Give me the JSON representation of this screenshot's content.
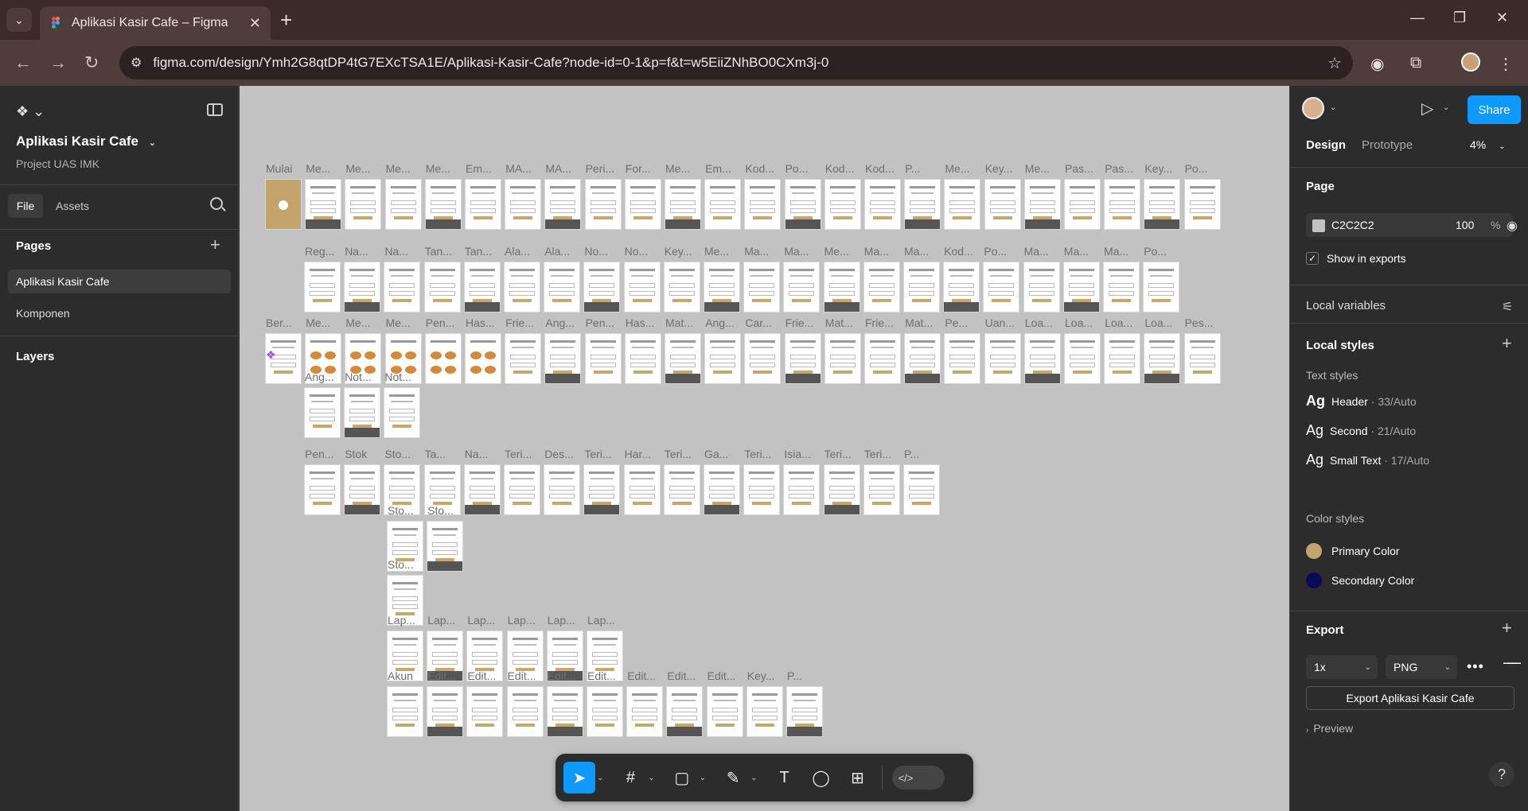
{
  "browser": {
    "tab_title": "Aplikasi Kasir Cafe – Figma",
    "url": "figma.com/design/Ymh2G8qtDP4tG7EXcTSA1E/Aplikasi-Kasir-Cafe?node-id=0-1&p=f&t=w5EiiZNhBO0CXm3j-0"
  },
  "left_panel": {
    "project_title": "Aplikasi Kasir Cafe",
    "project_subtitle": "Project UAS IMK",
    "tabs": [
      "File",
      "Assets"
    ],
    "pages_heading": "Pages",
    "pages": [
      "Aplikasi Kasir Cafe",
      "Komponen"
    ],
    "layers_heading": "Layers"
  },
  "canvas": {
    "background": "#C2C2C2",
    "rows": [
      {
        "labels": [
          "Mulai",
          "Me...",
          "Me...",
          "Me...",
          "Me...",
          "Em...",
          "MA...",
          "MA...",
          "Peri...",
          "For...",
          "Me...",
          "Em...",
          "Kod...",
          "Po...",
          "Kod...",
          "Kod...",
          "P...",
          "Me...",
          "Key...",
          "Me...",
          "Pas...",
          "Pas...",
          "Key...",
          "Po..."
        ]
      },
      {
        "labels": [
          "Reg...",
          "Na...",
          "Na...",
          "Tan...",
          "Tan...",
          "Ala...",
          "Ala...",
          "No...",
          "No...",
          "Key...",
          "Me...",
          "Ma...",
          "Ma...",
          "Me...",
          "Ma...",
          "Ma...",
          "Kod...",
          "Po...",
          "Ma...",
          "Ma...",
          "Ma...",
          "Po..."
        ]
      },
      {
        "labels": [
          "Ber...",
          "Me...",
          "Me...",
          "Me...",
          "Pen...",
          "Has...",
          "Frie...",
          "Ang...",
          "Pen...",
          "Has...",
          "Mat...",
          "Ang...",
          "Car...",
          "Frie...",
          "Mat...",
          "Frie...",
          "Mat...",
          "Pe...",
          "Uan...",
          "Loa...",
          "Loa...",
          "Loa...",
          "Loa...",
          "Pes..."
        ]
      },
      {
        "labels": [
          "Ang...",
          "Not...",
          "Not..."
        ]
      },
      {
        "labels": [
          "Pen...",
          "Stok",
          "Sto...",
          "Ta...",
          "Na...",
          "Teri...",
          "Des...",
          "Teri...",
          "Har...",
          "Teri...",
          "Ga...",
          "Teri...",
          "Isia...",
          "Teri...",
          "Teri...",
          "P..."
        ]
      },
      {
        "labels": [
          "Sto...",
          "Sto..."
        ]
      },
      {
        "labels": [
          "Sto..."
        ]
      },
      {
        "labels": [
          "Lap...",
          "Lap...",
          "Lap...",
          "Lap...",
          "Lap...",
          "Lap..."
        ]
      },
      {
        "labels": [
          "Akun",
          "Edit...",
          "Edit...",
          "Edit...",
          "Edit...",
          "Edit...",
          "Edit...",
          "Edit...",
          "Edit...",
          "Key...",
          "P..."
        ]
      }
    ]
  },
  "right_panel": {
    "share_label": "Share",
    "tabs": [
      "Design",
      "Prototype"
    ],
    "zoom": "4%",
    "page_heading": "Page",
    "page_color_hex": "C2C2C2",
    "page_opacity": "100",
    "page_opacity_unit": "%",
    "show_in_exports": "Show in exports",
    "local_variables": "Local variables",
    "local_styles": "Local styles",
    "text_styles_heading": "Text styles",
    "text_styles": [
      {
        "name": "Header",
        "meta": " · 33/Auto"
      },
      {
        "name": "Second",
        "meta": " · 21/Auto"
      },
      {
        "name": "Small Text",
        "meta": " · 17/Auto"
      }
    ],
    "color_styles_heading": "Color styles",
    "color_styles": [
      {
        "name": "Primary Color",
        "color": "#C5A46B"
      },
      {
        "name": "Secondary Color",
        "color": "#0A0A5A"
      }
    ],
    "export_heading": "Export",
    "export_scale": "1x",
    "export_format": "PNG",
    "export_button": "Export Aplikasi Kasir Cafe",
    "preview_label": "Preview",
    "help": "?"
  },
  "colors": {
    "accent": "#0D99FF",
    "brand_gold": "#C5A46B"
  }
}
